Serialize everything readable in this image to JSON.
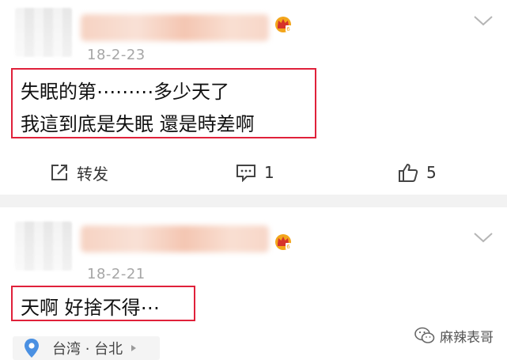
{
  "posts": [
    {
      "date": "18-2-23",
      "content_lines": [
        "失眠的第⋯⋯⋯多少天了",
        "我這到底是失眠 還是時差啊"
      ],
      "actions": {
        "repost_label": "转发",
        "comment_count": "1",
        "like_count": "5"
      }
    },
    {
      "date": "18-2-21",
      "content_lines": [
        "天啊 好捨不得⋯"
      ],
      "location": "台湾 · 台北"
    }
  ],
  "watermark": {
    "text": "麻辣表哥"
  },
  "colors": {
    "highlight_box": "#e0213a",
    "meta_text": "#a6a6a6",
    "location_pin": "#4a90e2",
    "crown_gold": "#f3a51b",
    "crown_red": "#d6332b"
  },
  "icons": {
    "repost": "repost-icon",
    "comment": "comment-icon",
    "like": "thumbs-up-icon",
    "menu": "chevron-down-icon",
    "member": "vip-crown-icon",
    "location": "location-pin-icon",
    "watermark": "wechat-icon"
  }
}
